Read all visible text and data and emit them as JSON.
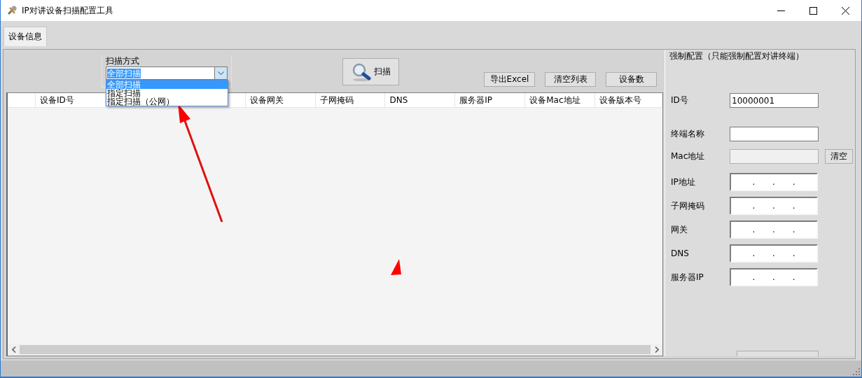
{
  "window": {
    "title": "IP对讲设备扫描配置工具"
  },
  "tabs": [
    {
      "label": "设备信息",
      "selected": true
    }
  ],
  "scan_mode": {
    "label": "扫描方式",
    "value": "全部扫描",
    "expanded": true,
    "options": [
      {
        "label": "全部扫描",
        "selected": true
      },
      {
        "label": "指定扫描",
        "selected": false
      },
      {
        "label": "指定扫描（公网）",
        "selected": false
      }
    ]
  },
  "scan_button": {
    "label": "扫描"
  },
  "buttons": [
    "导出Excel",
    "清空列表",
    "设备数"
  ],
  "table": {
    "columns": [
      {},
      {
        "label": "设备ID号"
      },
      {},
      {},
      {
        "label": "设备网关"
      },
      {
        "label": "子网掩码"
      },
      {
        "label": "DNS"
      },
      {
        "label": "服务器IP"
      },
      {
        "label": "设备Mac地址"
      },
      {
        "label": "设备版本号"
      }
    ]
  },
  "config": {
    "title": "强制配置（只能强制配置对讲终端）",
    "fields": [
      {
        "label": "ID号",
        "kind": "text",
        "value": "10000001",
        "disabled": false
      },
      {
        "label": "终端名称",
        "kind": "text",
        "disabled": false
      },
      {
        "label": "Mac地址",
        "kind": "text",
        "disabled": true,
        "button": "清空"
      },
      {
        "label": "IP地址",
        "kind": "ip",
        "separator": "."
      },
      {
        "label": "子网掩码",
        "kind": "ip",
        "separator": "."
      },
      {
        "label": "网关",
        "kind": "ip",
        "separator": "."
      },
      {
        "label": "DNS",
        "kind": "ip",
        "separator": "."
      },
      {
        "label": "服务器IP",
        "kind": "ip",
        "separator": "."
      }
    ]
  }
}
